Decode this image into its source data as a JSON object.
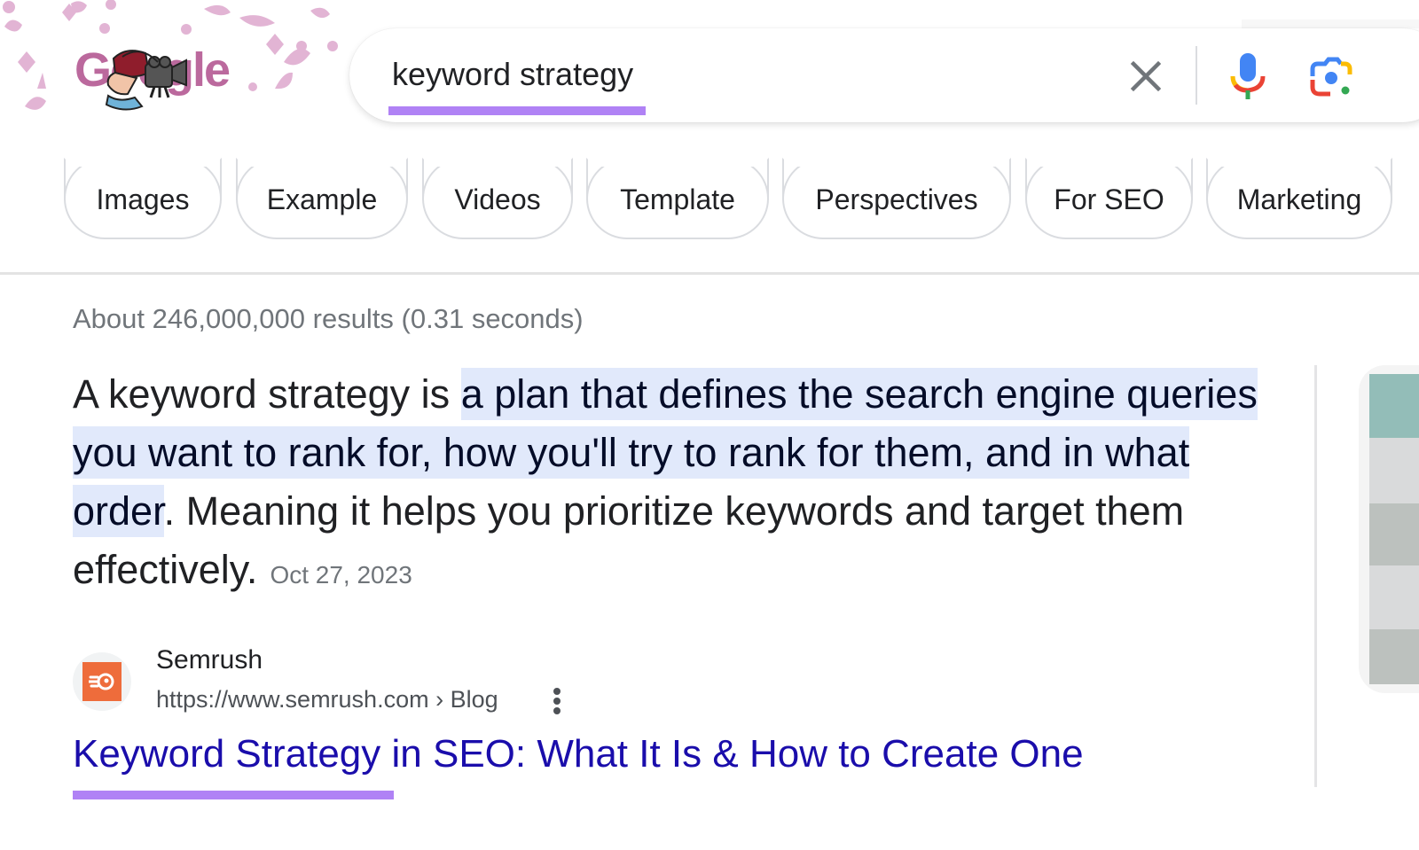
{
  "header": {
    "logo_text": "Google",
    "logo_alt": "Google Doodle",
    "search": {
      "value": "keyword strategy",
      "placeholder": ""
    },
    "buttons": {
      "clear": "Clear",
      "voice": "Search by voice",
      "lens": "Search by image"
    }
  },
  "chips": [
    {
      "label": "Images"
    },
    {
      "label": "Example"
    },
    {
      "label": "Videos"
    },
    {
      "label": "Template"
    },
    {
      "label": "Perspectives"
    },
    {
      "label": "For SEO"
    },
    {
      "label": "Marketing"
    }
  ],
  "results": {
    "stats": "About 246,000,000 results (0.31 seconds)",
    "featured_snippet": {
      "text_before": "A keyword strategy is ",
      "highlight": "a plan that defines the search engine queries you want to rank for, how you'll try to rank for them, and in what order",
      "text_after": ". Meaning it helps you prioritize keywords and target them effectively.",
      "date": "Oct 27, 2023"
    },
    "source": {
      "site_name": "Semrush",
      "url": "https://www.semrush.com › Blog",
      "title": "Keyword Strategy in SEO: What It Is & How to Create One"
    }
  },
  "colors": {
    "annotation_underline": "#b082f5",
    "snippet_highlight": "#e1e9fb",
    "link": "#1a0dab",
    "semrush_orange": "#ee6c3b",
    "doodle_pink": "#d9a8cb"
  }
}
